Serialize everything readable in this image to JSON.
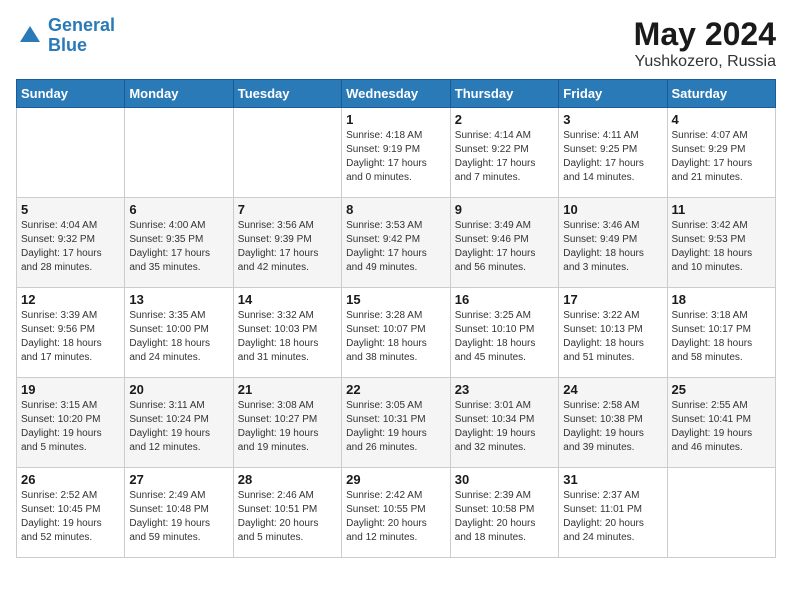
{
  "header": {
    "logo_line1": "General",
    "logo_line2": "Blue",
    "month_year": "May 2024",
    "location": "Yushkozero, Russia"
  },
  "weekdays": [
    "Sunday",
    "Monday",
    "Tuesday",
    "Wednesday",
    "Thursday",
    "Friday",
    "Saturday"
  ],
  "weeks": [
    [
      {
        "day": "",
        "detail": ""
      },
      {
        "day": "",
        "detail": ""
      },
      {
        "day": "",
        "detail": ""
      },
      {
        "day": "1",
        "detail": "Sunrise: 4:18 AM\nSunset: 9:19 PM\nDaylight: 17 hours\nand 0 minutes."
      },
      {
        "day": "2",
        "detail": "Sunrise: 4:14 AM\nSunset: 9:22 PM\nDaylight: 17 hours\nand 7 minutes."
      },
      {
        "day": "3",
        "detail": "Sunrise: 4:11 AM\nSunset: 9:25 PM\nDaylight: 17 hours\nand 14 minutes."
      },
      {
        "day": "4",
        "detail": "Sunrise: 4:07 AM\nSunset: 9:29 PM\nDaylight: 17 hours\nand 21 minutes."
      }
    ],
    [
      {
        "day": "5",
        "detail": "Sunrise: 4:04 AM\nSunset: 9:32 PM\nDaylight: 17 hours\nand 28 minutes."
      },
      {
        "day": "6",
        "detail": "Sunrise: 4:00 AM\nSunset: 9:35 PM\nDaylight: 17 hours\nand 35 minutes."
      },
      {
        "day": "7",
        "detail": "Sunrise: 3:56 AM\nSunset: 9:39 PM\nDaylight: 17 hours\nand 42 minutes."
      },
      {
        "day": "8",
        "detail": "Sunrise: 3:53 AM\nSunset: 9:42 PM\nDaylight: 17 hours\nand 49 minutes."
      },
      {
        "day": "9",
        "detail": "Sunrise: 3:49 AM\nSunset: 9:46 PM\nDaylight: 17 hours\nand 56 minutes."
      },
      {
        "day": "10",
        "detail": "Sunrise: 3:46 AM\nSunset: 9:49 PM\nDaylight: 18 hours\nand 3 minutes."
      },
      {
        "day": "11",
        "detail": "Sunrise: 3:42 AM\nSunset: 9:53 PM\nDaylight: 18 hours\nand 10 minutes."
      }
    ],
    [
      {
        "day": "12",
        "detail": "Sunrise: 3:39 AM\nSunset: 9:56 PM\nDaylight: 18 hours\nand 17 minutes."
      },
      {
        "day": "13",
        "detail": "Sunrise: 3:35 AM\nSunset: 10:00 PM\nDaylight: 18 hours\nand 24 minutes."
      },
      {
        "day": "14",
        "detail": "Sunrise: 3:32 AM\nSunset: 10:03 PM\nDaylight: 18 hours\nand 31 minutes."
      },
      {
        "day": "15",
        "detail": "Sunrise: 3:28 AM\nSunset: 10:07 PM\nDaylight: 18 hours\nand 38 minutes."
      },
      {
        "day": "16",
        "detail": "Sunrise: 3:25 AM\nSunset: 10:10 PM\nDaylight: 18 hours\nand 45 minutes."
      },
      {
        "day": "17",
        "detail": "Sunrise: 3:22 AM\nSunset: 10:13 PM\nDaylight: 18 hours\nand 51 minutes."
      },
      {
        "day": "18",
        "detail": "Sunrise: 3:18 AM\nSunset: 10:17 PM\nDaylight: 18 hours\nand 58 minutes."
      }
    ],
    [
      {
        "day": "19",
        "detail": "Sunrise: 3:15 AM\nSunset: 10:20 PM\nDaylight: 19 hours\nand 5 minutes."
      },
      {
        "day": "20",
        "detail": "Sunrise: 3:11 AM\nSunset: 10:24 PM\nDaylight: 19 hours\nand 12 minutes."
      },
      {
        "day": "21",
        "detail": "Sunrise: 3:08 AM\nSunset: 10:27 PM\nDaylight: 19 hours\nand 19 minutes."
      },
      {
        "day": "22",
        "detail": "Sunrise: 3:05 AM\nSunset: 10:31 PM\nDaylight: 19 hours\nand 26 minutes."
      },
      {
        "day": "23",
        "detail": "Sunrise: 3:01 AM\nSunset: 10:34 PM\nDaylight: 19 hours\nand 32 minutes."
      },
      {
        "day": "24",
        "detail": "Sunrise: 2:58 AM\nSunset: 10:38 PM\nDaylight: 19 hours\nand 39 minutes."
      },
      {
        "day": "25",
        "detail": "Sunrise: 2:55 AM\nSunset: 10:41 PM\nDaylight: 19 hours\nand 46 minutes."
      }
    ],
    [
      {
        "day": "26",
        "detail": "Sunrise: 2:52 AM\nSunset: 10:45 PM\nDaylight: 19 hours\nand 52 minutes."
      },
      {
        "day": "27",
        "detail": "Sunrise: 2:49 AM\nSunset: 10:48 PM\nDaylight: 19 hours\nand 59 minutes."
      },
      {
        "day": "28",
        "detail": "Sunrise: 2:46 AM\nSunset: 10:51 PM\nDaylight: 20 hours\nand 5 minutes."
      },
      {
        "day": "29",
        "detail": "Sunrise: 2:42 AM\nSunset: 10:55 PM\nDaylight: 20 hours\nand 12 minutes."
      },
      {
        "day": "30",
        "detail": "Sunrise: 2:39 AM\nSunset: 10:58 PM\nDaylight: 20 hours\nand 18 minutes."
      },
      {
        "day": "31",
        "detail": "Sunrise: 2:37 AM\nSunset: 11:01 PM\nDaylight: 20 hours\nand 24 minutes."
      },
      {
        "day": "",
        "detail": ""
      }
    ]
  ]
}
